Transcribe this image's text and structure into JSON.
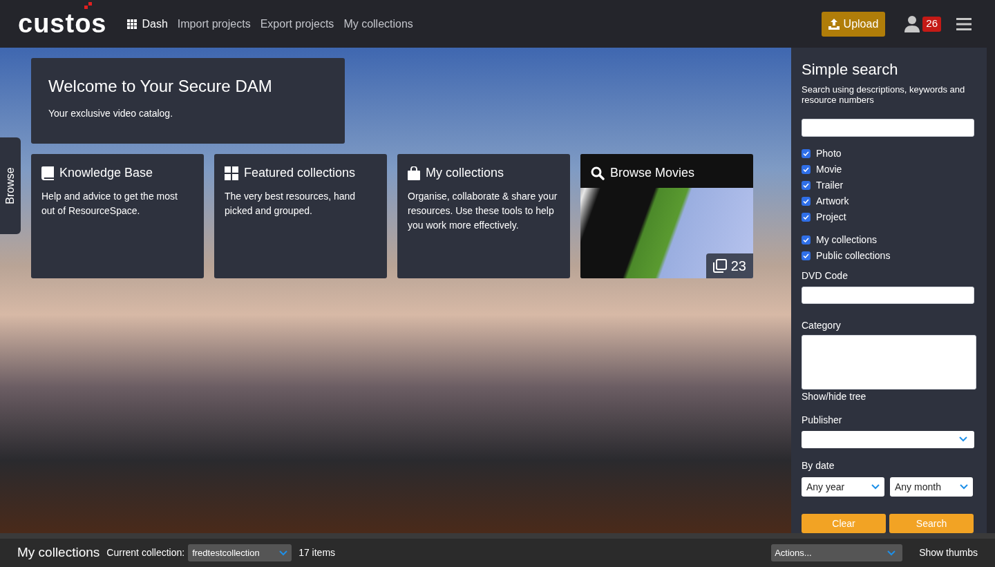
{
  "header": {
    "logo": "custos",
    "nav": [
      {
        "label": "Dash",
        "selected": true
      },
      {
        "label": "Import projects",
        "selected": false
      },
      {
        "label": "Export projects",
        "selected": false
      },
      {
        "label": "My collections",
        "selected": false
      }
    ],
    "upload": "Upload",
    "badge": "26"
  },
  "browse_tab": "Browse",
  "welcome": {
    "title": "Welcome to Your Secure DAM",
    "text": "Your exclusive video catalog."
  },
  "tiles": [
    {
      "kind": "text",
      "title": "Knowledge Base",
      "text": "Help and advice to get the most out of ResourceSpace."
    },
    {
      "kind": "text",
      "title": "Featured collections",
      "text": "The very best resources, hand picked and grouped."
    },
    {
      "kind": "text",
      "title": "My collections",
      "text": "Organise, collaborate & share your resources. Use these tools to help you work more effectively."
    },
    {
      "kind": "preview",
      "title": "Browse Movies",
      "count": "23"
    }
  ],
  "search": {
    "title": "Simple search",
    "subtitle": "Search using descriptions, keywords and resource numbers",
    "resource_types": [
      {
        "label": "Photo",
        "checked": true
      },
      {
        "label": "Movie",
        "checked": true
      },
      {
        "label": "Trailer",
        "checked": true
      },
      {
        "label": "Artwork",
        "checked": true
      },
      {
        "label": "Project",
        "checked": true
      }
    ],
    "collection_types": [
      {
        "label": "My collections",
        "checked": true
      },
      {
        "label": "Public collections",
        "checked": true
      }
    ],
    "dvd_code_label": "DVD Code",
    "category_label": "Category",
    "tree_toggle": "Show/hide tree",
    "publisher_label": "Publisher",
    "by_date_label": "By date",
    "year": "Any year",
    "month": "Any month",
    "buttons": [
      "Clear",
      "Search"
    ]
  },
  "collection_bar": {
    "title": "My collections",
    "current_label": "Current collection:",
    "collection": "fredtestcollection",
    "items": "17 items",
    "actions": "Actions...",
    "show_thumbs": "Show thumbs"
  }
}
